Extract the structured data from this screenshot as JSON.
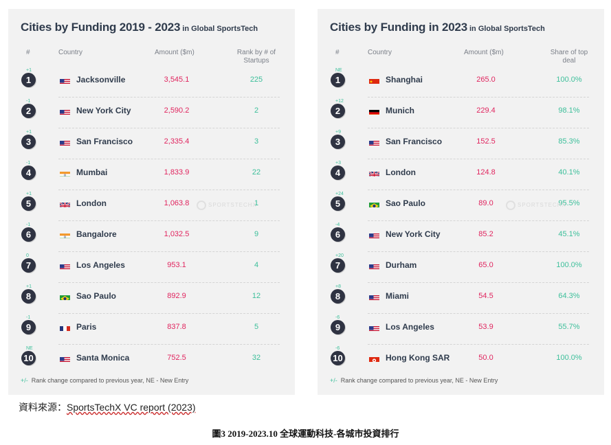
{
  "left": {
    "title": "Cities by Funding 2019 - 2023",
    "title_suffix": "in Global SportsTech",
    "headers": {
      "hash": "#",
      "country": "Country",
      "amount": "Amount  ($m)",
      "extra_line1": "Rank by # of",
      "extra_line2": "Startups"
    },
    "rows": [
      {
        "rank": "1",
        "change": "+1",
        "flag": "us",
        "city": "Jacksonville",
        "amount": "3,545.1",
        "extra": "225"
      },
      {
        "rank": "2",
        "change": "-1",
        "flag": "us",
        "city": "New York City",
        "amount": "2,590.2",
        "extra": "2"
      },
      {
        "rank": "3",
        "change": "+1",
        "flag": "us",
        "city": "San Francisco",
        "amount": "2,335.4",
        "extra": "3"
      },
      {
        "rank": "4",
        "change": "-1",
        "flag": "in",
        "city": "Mumbai",
        "amount": "1,833.9",
        "extra": "22"
      },
      {
        "rank": "5",
        "change": "+1",
        "flag": "gb",
        "city": "London",
        "amount": "1,063.8",
        "extra": "1"
      },
      {
        "rank": "6",
        "change": "-1",
        "flag": "in",
        "city": "Bangalore",
        "amount": "1,032.5",
        "extra": "9"
      },
      {
        "rank": "7",
        "change": "0",
        "flag": "us",
        "city": "Los Angeles",
        "amount": "953.1",
        "extra": "4"
      },
      {
        "rank": "8",
        "change": "+1",
        "flag": "br",
        "city": "Sao Paulo",
        "amount": "892.9",
        "extra": "12"
      },
      {
        "rank": "9",
        "change": "-1",
        "flag": "fr",
        "city": "Paris",
        "amount": "837.8",
        "extra": "5"
      },
      {
        "rank": "10",
        "change": "NE",
        "flag": "us",
        "city": "Santa Monica",
        "amount": "752.5",
        "extra": "32"
      }
    ],
    "footnote_symbol": "+/-",
    "footnote": "Rank change compared to previous year, NE - New Entry"
  },
  "right": {
    "title": "Cities by Funding in 2023",
    "title_suffix": "in Global SportsTech",
    "headers": {
      "hash": "#",
      "country": "Country",
      "amount": "Amount  ($m)",
      "extra_line1": "Share of top",
      "extra_line2": "deal"
    },
    "rows": [
      {
        "rank": "1",
        "change": "NE",
        "flag": "cn",
        "city": "Shanghai",
        "amount": "265.0",
        "extra": "100.0%"
      },
      {
        "rank": "2",
        "change": "+12",
        "flag": "de",
        "city": "Munich",
        "amount": "229.4",
        "extra": "98.1%"
      },
      {
        "rank": "3",
        "change": "+9",
        "flag": "us",
        "city": "San Francisco",
        "amount": "152.5",
        "extra": "85.3%"
      },
      {
        "rank": "4",
        "change": "+3",
        "flag": "gb",
        "city": "London",
        "amount": "124.8",
        "extra": "40.1%"
      },
      {
        "rank": "5",
        "change": "+24",
        "flag": "br",
        "city": "Sao Paulo",
        "amount": "89.0",
        "extra": "95.5%"
      },
      {
        "rank": "6",
        "change": "-4",
        "flag": "us",
        "city": "New York City",
        "amount": "85.2",
        "extra": "45.1%"
      },
      {
        "rank": "7",
        "change": "+20",
        "flag": "us",
        "city": "Durham",
        "amount": "65.0",
        "extra": "100.0%"
      },
      {
        "rank": "8",
        "change": "+8",
        "flag": "us",
        "city": "Miami",
        "amount": "54.5",
        "extra": "64.3%"
      },
      {
        "rank": "9",
        "change": "-6",
        "flag": "us",
        "city": "Los Angeles",
        "amount": "53.9",
        "extra": "55.7%"
      },
      {
        "rank": "10",
        "change": "-6",
        "flag": "hk",
        "city": "Hong Kong SAR",
        "amount": "50.0",
        "extra": "100.0%"
      }
    ],
    "footnote_symbol": "+/-",
    "footnote": "Rank change compared to previous year, NE - New Entry"
  },
  "watermark": "SPORTSTECHX",
  "source": {
    "label": "資料來源：",
    "text": "SportsTechX VC report (2023)"
  },
  "caption": "圖3   2019-2023.10 全球運動科技-各城市投資排行",
  "colors": {
    "amount": "#e0245e",
    "extra": "#3cbf9a",
    "badge": "#2f3342",
    "panel": "#f2f2f2"
  }
}
